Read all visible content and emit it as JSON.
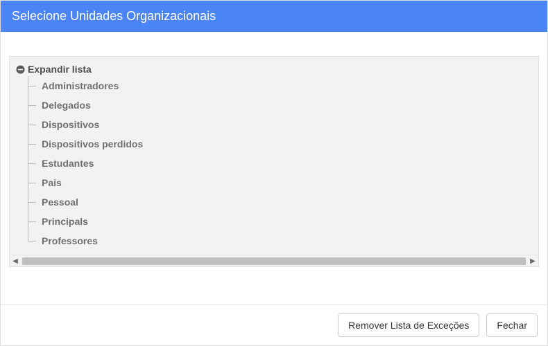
{
  "header": {
    "title": "Selecione Unidades Organizacionais"
  },
  "tree": {
    "root_label": "Expandir lista",
    "items": [
      {
        "label": "Administradores"
      },
      {
        "label": "Delegados"
      },
      {
        "label": "Dispositivos"
      },
      {
        "label": "Dispositivos perdidos"
      },
      {
        "label": "Estudantes"
      },
      {
        "label": "Pais"
      },
      {
        "label": "Pessoal"
      },
      {
        "label": "Principals"
      },
      {
        "label": "Professores"
      }
    ]
  },
  "footer": {
    "remove_label": "Remover Lista de Exceções",
    "close_label": "Fechar"
  }
}
